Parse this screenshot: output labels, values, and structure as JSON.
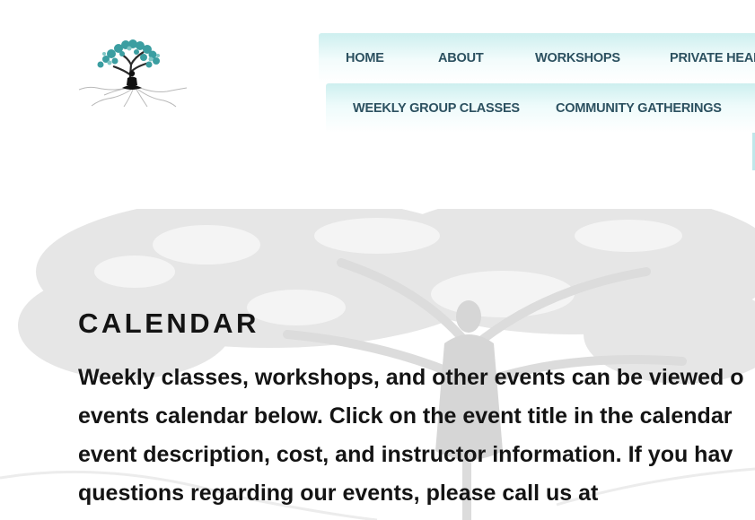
{
  "site": {
    "logo_icon": "tree-meditation-logo-icon",
    "colors": {
      "nav_gradient_top": "#cdefef",
      "nav_text": "#2c5160",
      "heading_text": "#141414",
      "logo_foliage": "#3b9ea1"
    }
  },
  "nav": {
    "row1": [
      {
        "label": "HOME"
      },
      {
        "label": "ABOUT"
      },
      {
        "label": "WORKSHOPS"
      },
      {
        "label": "PRIVATE HEAL"
      }
    ],
    "row2": [
      {
        "label": "WEEKLY GROUP CLASSES"
      },
      {
        "label": "COMMUNITY GATHERINGS"
      }
    ]
  },
  "content": {
    "title": "CALENDAR",
    "intro_lines": [
      "Weekly classes, workshops, and other events can be viewed o",
      "events calendar below. Click on the event title in the calendar",
      "event description, cost, and instructor information. If you hav",
      "questions regarding our events, please call us at"
    ]
  }
}
